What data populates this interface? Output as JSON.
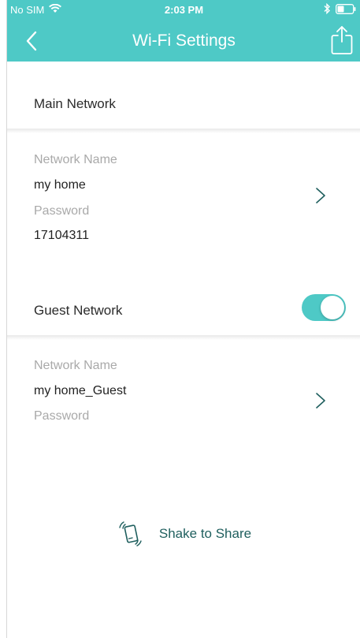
{
  "status_bar": {
    "carrier": "No SIM",
    "time": "2:03 PM"
  },
  "nav": {
    "title": "Wi-Fi Settings"
  },
  "main_network": {
    "header": "Main Network",
    "name_label": "Network Name",
    "name_value": "my home",
    "password_label": "Password",
    "password_value": "17104311"
  },
  "guest_network": {
    "header": "Guest Network",
    "enabled": true,
    "name_label": "Network Name",
    "name_value": "my home_Guest",
    "password_label": "Password"
  },
  "shake": {
    "label": "Shake to Share"
  },
  "colors": {
    "accent": "#4ec9c6",
    "text": "#2b2b2b",
    "muted": "#a9a9a9",
    "link": "#1f5f5e"
  }
}
